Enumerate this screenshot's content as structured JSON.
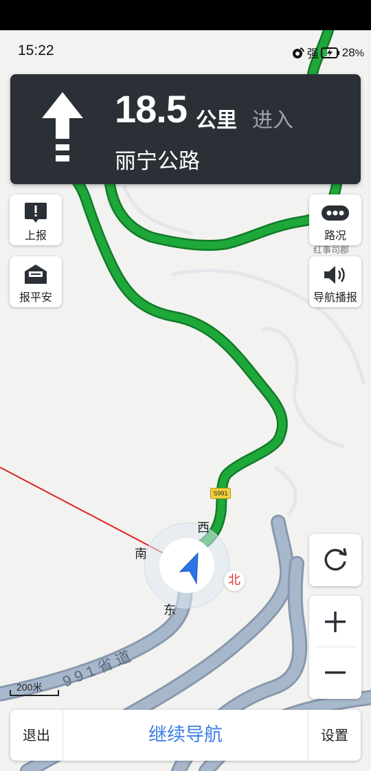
{
  "status_bar": {
    "time": "15:22",
    "signal_label": "强",
    "battery": "28",
    "battery_unit": "%"
  },
  "guidance": {
    "maneuver_icon": "straight-arrow-icon",
    "distance": "18.5",
    "distance_unit": "公里",
    "action": "进入",
    "road": "丽宁公路"
  },
  "left_buttons": [
    {
      "label": "上报",
      "icon": "report-icon"
    },
    {
      "label": "报平安",
      "icon": "envelope-icon"
    }
  ],
  "right_buttons": [
    {
      "label": "路况",
      "icon": "traffic-icon"
    },
    {
      "label": "导航播报",
      "icon": "speaker-icon"
    }
  ],
  "map": {
    "compass": {
      "north": "北",
      "south": "南",
      "east": "东",
      "west": "西"
    },
    "route_sign": "S991",
    "road_label": "991省道",
    "poi_label": "红事司郡",
    "scale_text": "200米",
    "colors": {
      "route": "#1ea83a",
      "road": "#9fb2c8",
      "vehicle": "#2a74e6",
      "guide_line": "#e02020"
    }
  },
  "controls": {
    "refresh_icon": "refresh-icon",
    "zoom_in_icon": "plus-icon",
    "zoom_out_icon": "minus-icon"
  },
  "bottom_bar": {
    "exit": "退出",
    "continue": "继续导航",
    "settings": "设置"
  }
}
